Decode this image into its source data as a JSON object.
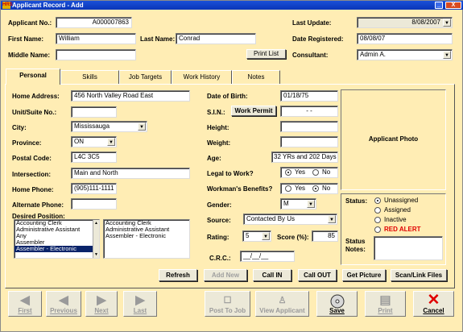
{
  "window": {
    "title": "Applicant Record - Add",
    "app_badge": "HRS",
    "min": "_",
    "close": "X"
  },
  "header": {
    "applicant_no_label": "Applicant No.:",
    "applicant_no": "A000007863",
    "first_name_label": "First Name:",
    "first_name": "William",
    "last_name_label": "Last Name:",
    "last_name": "Conrad",
    "middle_name_label": "Middle Name:",
    "middle_name": "",
    "print_list": "Print List",
    "last_update_label": "Last Update:",
    "last_update": "8/08/2007",
    "date_registered_label": "Date Registered:",
    "date_registered": "08/08/07",
    "consultant_label": "Consultant:",
    "consultant": "Admin A."
  },
  "tabs": [
    "Personal",
    "Skills",
    "Job Targets",
    "Work History",
    "Notes"
  ],
  "personal": {
    "home_address_label": "Home Address:",
    "home_address": "456 North Valley Road East",
    "unit_label": "Unit/Suite No.:",
    "unit": "",
    "city_label": "City:",
    "city": "Mississauga",
    "province_label": "Province:",
    "province": "ON",
    "postal_label": "Postal Code:",
    "postal": "L4C 3C5",
    "intersection_label": "Intersection:",
    "intersection": "Main and North",
    "home_phone_label": "Home Phone:",
    "home_phone": "(905)111-1111",
    "alt_phone_label": "Alternate Phone:",
    "alt_phone": "",
    "desired_label": "Desired Position:",
    "desired_options": [
      "Accounting Clerk",
      "Administrative Assistant",
      "Any",
      "Assembler",
      "Assembler - Electronic"
    ],
    "desired_selected": [
      "Accounting Clerk",
      "Administrative Assistant",
      "Assembler - Electronic"
    ],
    "dob_label": "Date of Birth:",
    "dob": "01/18/75",
    "sin_label": "S.I.N.:",
    "work_permit": "Work Permit",
    "sin": "-  -",
    "height_label": "Height:",
    "height": "",
    "weight_label": "Weight:",
    "weight": "",
    "age_label": "Age:",
    "age": "32 YRs  and 202 Days",
    "legal_label": "Legal to Work?",
    "yes": "Yes",
    "no": "No",
    "workmans_label": "Workman's Benefits?",
    "gender_label": "Gender:",
    "gender": "M",
    "source_label": "Source:",
    "source": "Contacted By Us",
    "rating_label": "Rating:",
    "rating": "5",
    "score_label": "Score (%):",
    "score": "85",
    "crc_label": "C.R.C.:",
    "crc": "__/__/__",
    "photo_label": "Applicant Photo",
    "status_label": "Status:",
    "status_options": [
      "Unassigned",
      "Assigned",
      "Inactive",
      "RED ALERT"
    ],
    "status_notes_label": "Status Notes:",
    "buttons": {
      "refresh": "Refresh",
      "add_new": "Add New",
      "call_in": "Call IN",
      "call_out": "Call OUT",
      "get_picture": "Get Picture",
      "scan_link": "Scan/Link Files"
    }
  },
  "navbar": {
    "first": "First",
    "previous": "Previous",
    "next": "Next",
    "last": "Last",
    "post_to_job": "Post To Job",
    "view_applicant": "View Applicant",
    "save": "Save",
    "print": "Print",
    "cancel": "Cancel"
  }
}
